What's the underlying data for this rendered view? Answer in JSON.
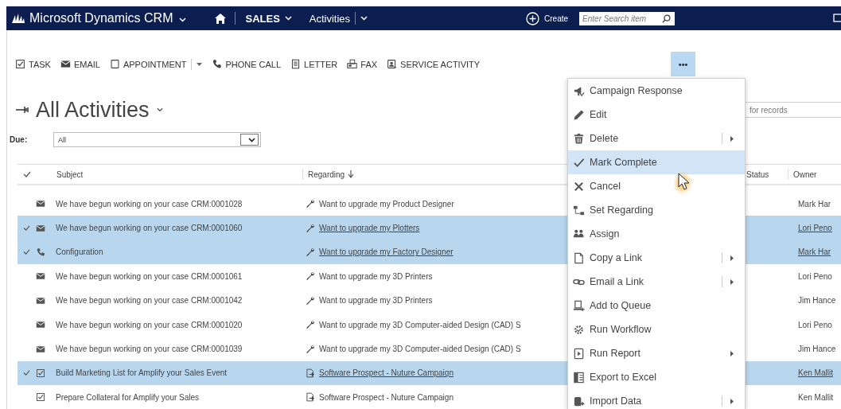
{
  "nav": {
    "app_title": "Microsoft Dynamics CRM",
    "area": "SALES",
    "entity": "Activities",
    "create": "Create",
    "search": {
      "placeholder": "Enter Search item"
    }
  },
  "commands": [
    {
      "label": "TASK",
      "kind": "task",
      "split": false
    },
    {
      "label": "EMAIL",
      "kind": "email",
      "split": false
    },
    {
      "label": "APPOINTMENT",
      "kind": "appointment",
      "split": true
    },
    {
      "label": "PHONE CALL",
      "kind": "phone",
      "split": false
    },
    {
      "label": "LETTER",
      "kind": "letter",
      "split": false
    },
    {
      "label": "FAX",
      "kind": "fax",
      "split": false
    },
    {
      "label": "SERVICE ACTIVITY",
      "kind": "service",
      "split": false
    }
  ],
  "more": {
    "label": "•••",
    "expanded": true
  },
  "view": {
    "title": "All Activities",
    "filter_label": "Due:",
    "filter_value": "All",
    "search": {
      "placeholder": "for records"
    }
  },
  "grid": {
    "columns": [
      {
        "label": "Subject",
        "sorted": false
      },
      {
        "label": "Regarding",
        "sorted": true
      },
      {
        "label": "Status",
        "sorted": false
      },
      {
        "label": "Owner",
        "sorted": false
      }
    ],
    "rows": [
      {
        "selected": false,
        "kind": "email",
        "subject": "We have begun working on your case CRM:0001028",
        "regarding": {
          "kind": "case",
          "text": "Want to upgrade my Product Designer"
        },
        "owner": "Mark Har"
      },
      {
        "selected": true,
        "kind": "email",
        "subject": "We have begun working on your case CRM:0001060",
        "regarding": {
          "kind": "case",
          "text": "Want to upgrade my Plotters"
        },
        "owner": "Lori Peno"
      },
      {
        "selected": true,
        "kind": "phone",
        "subject": "Configuration",
        "regarding": {
          "kind": "case",
          "text": "Want to upgrade my Factory Designer"
        },
        "owner": "Mark Har"
      },
      {
        "selected": false,
        "kind": "email",
        "subject": "We have begun working on your case CRM:0001061",
        "regarding": {
          "kind": "case",
          "text": "Want to upgrade my 3D Printers"
        },
        "owner": "Lori Peno"
      },
      {
        "selected": false,
        "kind": "email",
        "subject": "We have begun working on your case CRM:0001042",
        "regarding": {
          "kind": "case",
          "text": "Want to upgrade my 3D Printers"
        },
        "owner": "Jim Hance"
      },
      {
        "selected": false,
        "kind": "email",
        "subject": "We have begun working on your case CRM:0001020",
        "regarding": {
          "kind": "case",
          "text": "Want to upgrade my 3D Computer-aided Design (CAD) S"
        },
        "owner": "Lori Peno"
      },
      {
        "selected": false,
        "kind": "email",
        "subject": "We have begun working on your case CRM:0001039",
        "regarding": {
          "kind": "case",
          "text": "Want to upgrade my 3D Computer-aided Design (CAD) S"
        },
        "owner": "Jim Hance"
      },
      {
        "selected": true,
        "kind": "task",
        "subject": "Build Marketing List for Amplify your Sales Event",
        "regarding": {
          "kind": "campaign",
          "text": "Software Prospect - Nuture Campaign"
        },
        "owner": "Ken Mallit"
      },
      {
        "selected": false,
        "kind": "task",
        "subject": "Prepare Collateral for Amplify your Sales",
        "regarding": {
          "kind": "campaign",
          "text": "Software Prospect - Nuture Campaign"
        },
        "owner": "Ken Mallit"
      }
    ]
  },
  "menu": [
    {
      "label": "Campaign Response",
      "kind": "plain",
      "highlighted": false
    },
    {
      "label": "Edit",
      "kind": "plain",
      "highlighted": false
    },
    {
      "label": "Delete",
      "kind": "split",
      "highlighted": false
    },
    {
      "label": "Mark Complete",
      "kind": "plain",
      "highlighted": true
    },
    {
      "label": "Cancel",
      "kind": "plain",
      "highlighted": false
    },
    {
      "label": "Set Regarding",
      "kind": "plain",
      "highlighted": false
    },
    {
      "label": "Assign",
      "kind": "plain",
      "highlighted": false
    },
    {
      "label": "Copy a Link",
      "kind": "split",
      "highlighted": false
    },
    {
      "label": "Email a Link",
      "kind": "split",
      "highlighted": false
    },
    {
      "label": "Add to Queue",
      "kind": "plain",
      "highlighted": false
    },
    {
      "label": "Run Workflow",
      "kind": "plain",
      "highlighted": false
    },
    {
      "label": "Run Report",
      "kind": "submenu",
      "highlighted": false
    },
    {
      "label": "Export to Excel",
      "kind": "plain",
      "highlighted": false
    },
    {
      "label": "Import Data",
      "kind": "split",
      "highlighted": false
    }
  ]
}
